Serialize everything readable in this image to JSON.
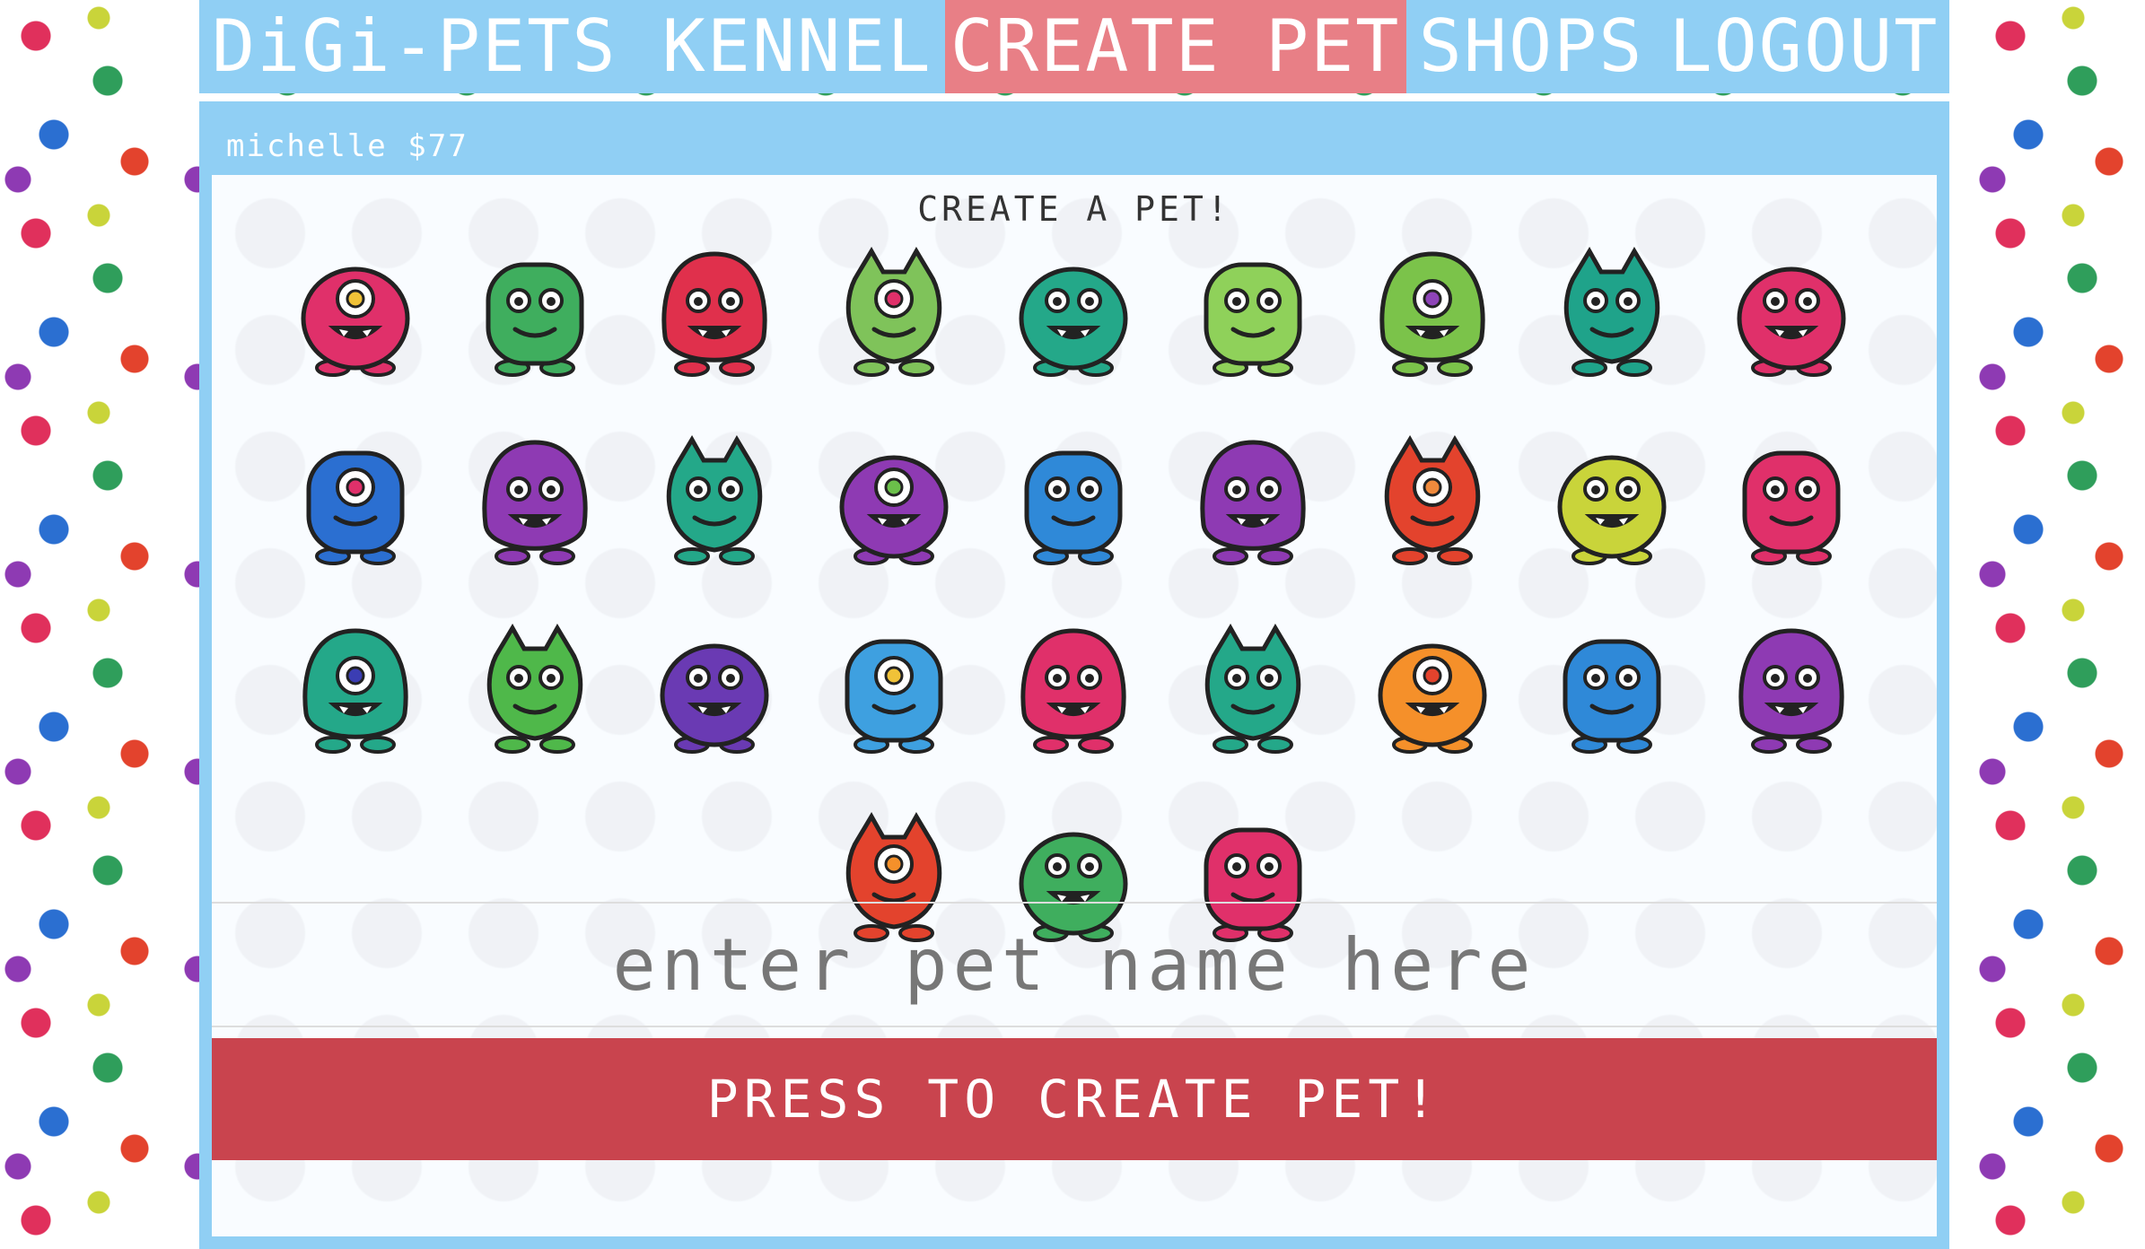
{
  "nav": {
    "brand": "DiGi-PETS KENNEL",
    "create_pet": "CREATE PET",
    "shops": "SHOPS",
    "logout": "LOGOUT"
  },
  "user": {
    "name": "michelle",
    "balance": "$77"
  },
  "create": {
    "title": "CREATE A PET!",
    "name_placeholder": "enter pet name here",
    "button_label": "PRESS TO CREATE PET!"
  },
  "colors": {
    "nav_bg": "#90cff4",
    "nav_active": "#e87f86",
    "button_bg": "#c9444e"
  },
  "pets": [
    {
      "icon": "one-eyed-pink-monster-icon",
      "body": "#e0306a",
      "accent": "#f0c238"
    },
    {
      "icon": "spiky-green-monster-icon",
      "body": "#3fae5e",
      "accent": "#2ab1a8"
    },
    {
      "icon": "stalk-eyed-red-monster-icon",
      "body": "#e0304c",
      "accent": "#9a47c6"
    },
    {
      "icon": "lime-alien-monster-icon",
      "body": "#7fc35a",
      "accent": "#e0306a"
    },
    {
      "icon": "teal-troll-monster-icon",
      "body": "#24a889",
      "accent": "#1d8a6d"
    },
    {
      "icon": "horned-lime-monster-icon",
      "body": "#8fd15a",
      "accent": "#e0306a"
    },
    {
      "icon": "hooded-green-monster-icon",
      "body": "#7bc34a",
      "accent": "#8e44b8"
    },
    {
      "icon": "teal-cyclops-monster-icon",
      "body": "#1fa38a",
      "accent": "#ffffff"
    },
    {
      "icon": "red-angry-monster-icon",
      "body": "#e0306a",
      "accent": "#f08a3c"
    },
    {
      "icon": "furry-blue-monster-icon",
      "body": "#2b6fd1",
      "accent": "#e0306a"
    },
    {
      "icon": "purple-screaming-monster-icon",
      "body": "#8e3ab3",
      "accent": "#e0306a"
    },
    {
      "icon": "green-cyclops-monster-icon",
      "body": "#24a889",
      "accent": "#e0306a"
    },
    {
      "icon": "purple-horned-monster-icon",
      "body": "#8e3ab3",
      "accent": "#6bc04a"
    },
    {
      "icon": "blue-horned-monster-icon",
      "body": "#2f89d8",
      "accent": "#f3d7a0"
    },
    {
      "icon": "purple-tongue-monster-icon",
      "body": "#8e3ab3",
      "accent": "#e0306a"
    },
    {
      "icon": "red-devil-monster-icon",
      "body": "#e3432d",
      "accent": "#f08a3c"
    },
    {
      "icon": "yellow-robot-monster-icon",
      "body": "#c9d43a",
      "accent": "#a6b02a"
    },
    {
      "icon": "pink-spotted-monster-icon",
      "body": "#e0306a",
      "accent": "#8e3ab3"
    },
    {
      "icon": "teal-big-monster-icon",
      "body": "#24a889",
      "accent": "#3b3db3"
    },
    {
      "icon": "green-one-eyed-monster-icon",
      "body": "#4fb84a",
      "accent": "#2f8f3a"
    },
    {
      "icon": "purple-spiky-monster-icon",
      "body": "#6a3ab3",
      "accent": "#3b6fd1"
    },
    {
      "icon": "blue-robot-monster-icon",
      "body": "#3ea0e0",
      "accent": "#f0c238"
    },
    {
      "icon": "pink-blob-monster-icon",
      "body": "#e0306a",
      "accent": "#f0c238"
    },
    {
      "icon": "teal-grinning-monster-icon",
      "body": "#24a889",
      "accent": "#1d8a6d"
    },
    {
      "icon": "orange-eyed-monster-icon",
      "body": "#f5902a",
      "accent": "#e3432d"
    },
    {
      "icon": "blue-bat-monster-icon",
      "body": "#2f89d8",
      "accent": "#2b6fd1"
    },
    {
      "icon": "purple-tall-monster-icon",
      "body": "#8e3ab3",
      "accent": "#f0c238"
    },
    {
      "icon": "red-round-monster-icon",
      "body": "#e3432d",
      "accent": "#f5902a"
    },
    {
      "icon": "green-slug-monster-icon",
      "body": "#3fae5e",
      "accent": "#e0306a"
    },
    {
      "icon": "magenta-cyclops-monster-icon",
      "body": "#e0306a",
      "accent": "#f0c238"
    }
  ]
}
